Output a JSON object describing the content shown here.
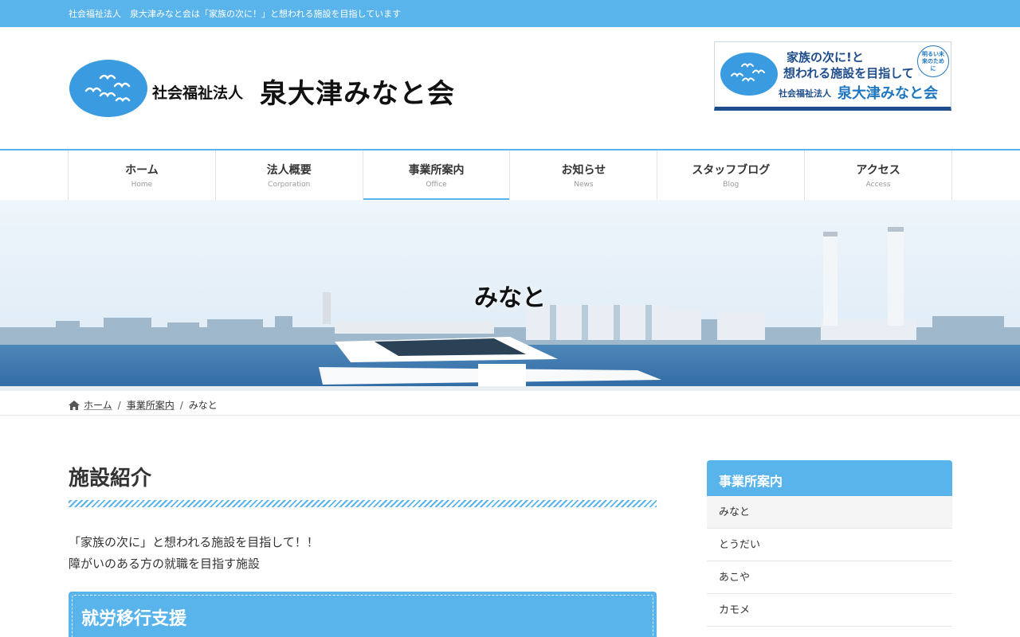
{
  "topbar": {
    "tagline": "社会福祉法人　泉大津みなと会は「家族の次に！」と想われる施設を目指しています"
  },
  "header": {
    "logo_small": "社会福祉法人",
    "logo_big": "泉大津みなと会",
    "banner": {
      "line1": "家族の次に!と",
      "line2": "想われる施設を目指して",
      "line3_small": "社会福祉法人",
      "line3_big": "泉大津みなと会",
      "circle_text": "明るい未来のために"
    }
  },
  "nav": {
    "items": [
      {
        "jp": "ホーム",
        "en": "Home"
      },
      {
        "jp": "法人概要",
        "en": "Corporation"
      },
      {
        "jp": "事業所案内",
        "en": "Office"
      },
      {
        "jp": "お知らせ",
        "en": "News"
      },
      {
        "jp": "スタッフブログ",
        "en": "Blog"
      },
      {
        "jp": "アクセス",
        "en": "Access"
      }
    ],
    "active_index": 2
  },
  "hero": {
    "title": "みなと"
  },
  "breadcrumb": {
    "home": "ホーム",
    "sep": "/",
    "level1": "事業所案内",
    "current": "みなと"
  },
  "main": {
    "title": "施設紹介",
    "intro_line1": "「家族の次に」と想われる施設を目指して！！",
    "intro_line2": "障がいのある方の就職を目指す施設",
    "section_title": "就労移行支援"
  },
  "sidebar": {
    "title": "事業所案内",
    "items": [
      "みなと",
      "とうだい",
      "あこや",
      "カモメ"
    ],
    "current_index": 0
  },
  "colors": {
    "accent": "#5ab4ec",
    "banner_navy": "#1f4d8c",
    "banner_blue": "#1f77c0"
  }
}
